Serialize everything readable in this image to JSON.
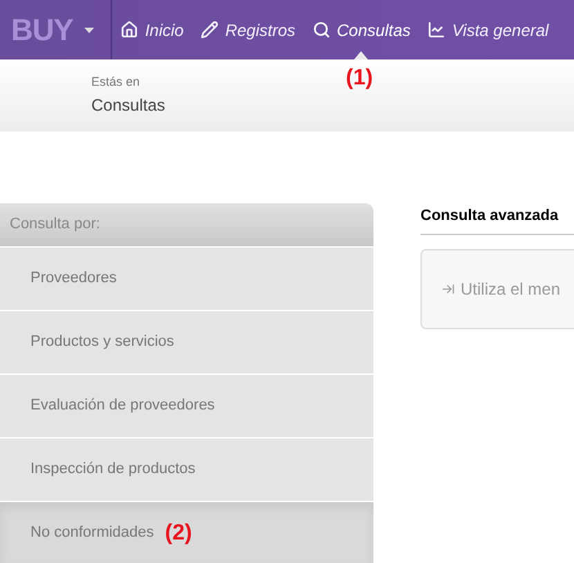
{
  "navbar": {
    "logo": "BUY",
    "items": [
      {
        "label": "Inicio",
        "kind": "home",
        "selected": false
      },
      {
        "label": "Registros",
        "kind": "pencil",
        "selected": false
      },
      {
        "label": "Consultas",
        "kind": "search",
        "selected": true
      },
      {
        "label": "Vista general",
        "kind": "chart",
        "selected": false
      }
    ]
  },
  "annotations": [
    "(1)",
    "(2)"
  ],
  "breadcrumb": {
    "caption": "Estás en",
    "current": "Consultas"
  },
  "sidebar": {
    "title": "Consulta por:",
    "items": [
      {
        "label": "Proveedores",
        "selected": false
      },
      {
        "label": "Productos y servicios",
        "selected": false
      },
      {
        "label": "Evaluación de proveedores",
        "selected": false
      },
      {
        "label": "Inspección de productos",
        "selected": false
      },
      {
        "label": "No conformidades",
        "selected": true
      }
    ]
  },
  "panel": {
    "title": "Consulta avanzada",
    "hint": "Utiliza el men"
  }
}
